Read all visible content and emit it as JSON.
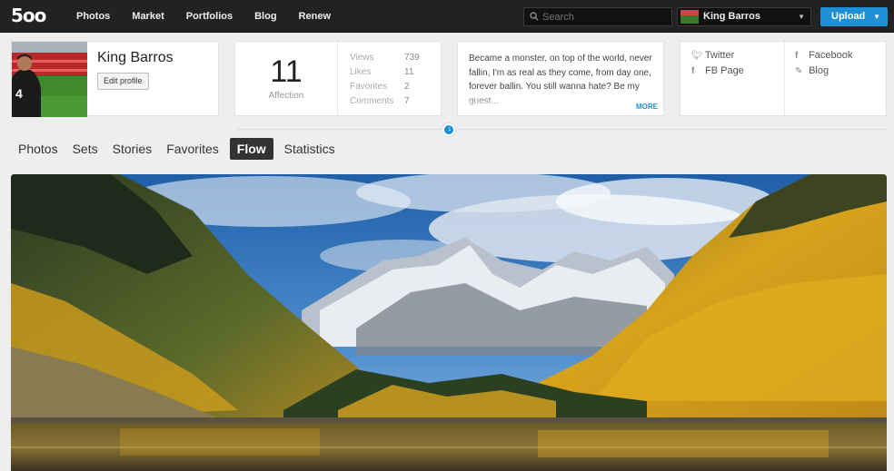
{
  "nav": {
    "logo": "5oo",
    "items": [
      "Photos",
      "Market",
      "Portfolios",
      "Blog",
      "Renew"
    ]
  },
  "search": {
    "placeholder": "Search"
  },
  "user": {
    "name": "King Barros"
  },
  "upload": {
    "label": "Upload"
  },
  "profile": {
    "name": "King Barros",
    "edit_label": "Edit profile"
  },
  "affection": {
    "value": "11",
    "label": "Affection",
    "stats": [
      {
        "label": "Views",
        "value": "739"
      },
      {
        "label": "Likes",
        "value": "11"
      },
      {
        "label": "Favorites",
        "value": "2"
      },
      {
        "label": "Comments",
        "value": "7"
      }
    ]
  },
  "about": {
    "text": "Became a monster, on top of the world, never fallin, I'm as real as they come, from day one, forever ballin. You still wanna hate? Be my guest...",
    "more_label": "MORE"
  },
  "links": {
    "twitter": "Twitter",
    "fb_page": "FB Page",
    "facebook": "Facebook",
    "blog": "Blog"
  },
  "tabs": [
    "Photos",
    "Sets",
    "Stories",
    "Favorites",
    "Flow",
    "Statistics"
  ],
  "active_tab": "Flow",
  "colors": {
    "accent": "#1e8fd6",
    "topbar": "#222222"
  }
}
